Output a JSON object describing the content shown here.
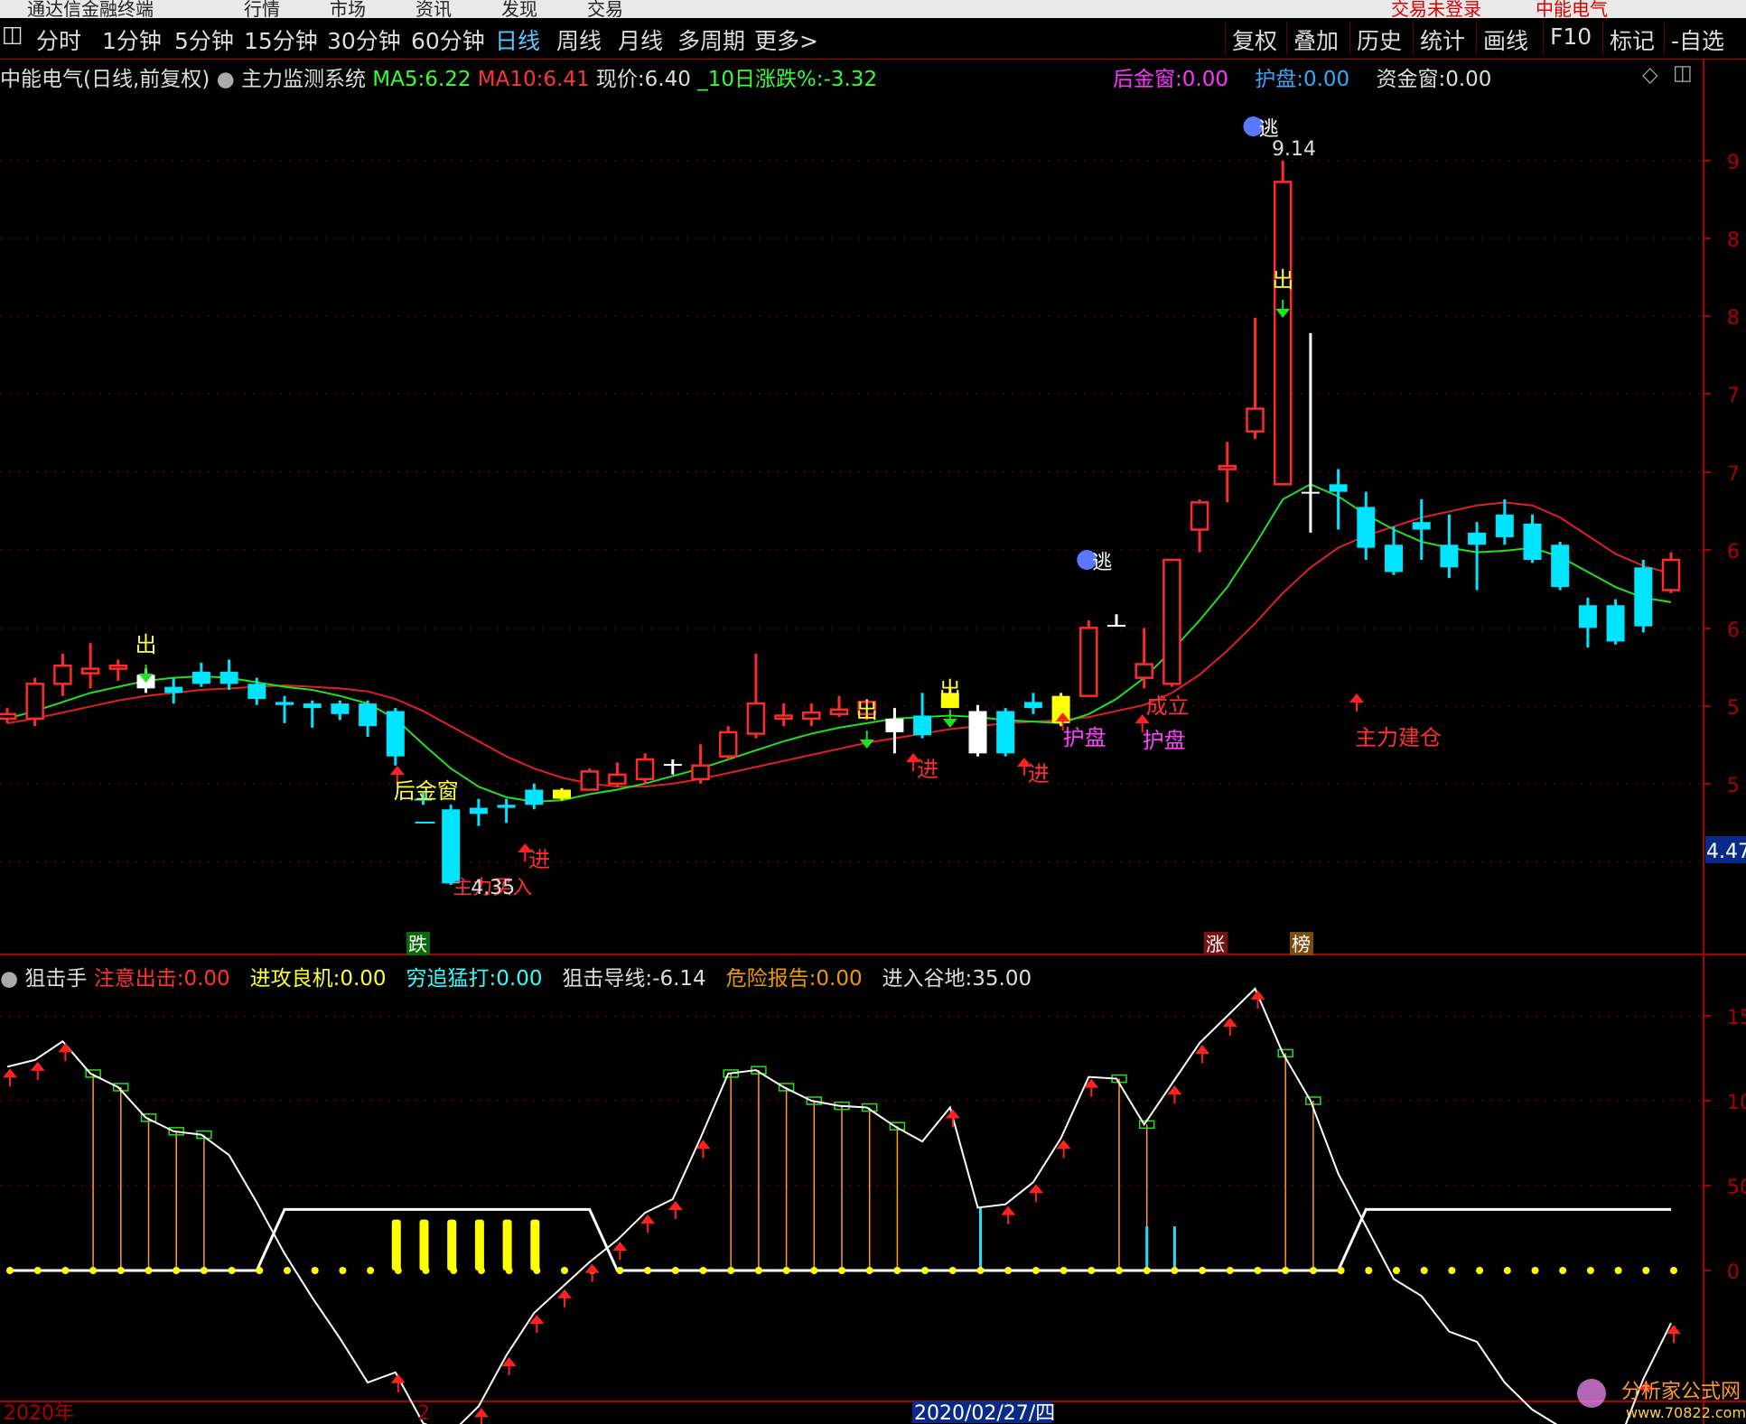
{
  "top_bar": {
    "left_items": [
      "通达信金融终端",
      "行情",
      "市场",
      "资讯",
      "发现",
      "交易"
    ],
    "right_items": [
      "交易未登录",
      "中能电气"
    ]
  },
  "toolbar": {
    "periods": [
      "分时",
      "1分钟",
      "5分钟",
      "15分钟",
      "30分钟",
      "60分钟",
      "日线",
      "周线",
      "月线",
      "多周期",
      "更多>"
    ],
    "active_period": "日线",
    "right_buttons": [
      "复权",
      "叠加",
      "历史",
      "统计",
      "画线",
      "F10",
      "标记",
      "-自选"
    ]
  },
  "main_info": {
    "stock": "中能电气(日线,前复权)",
    "indicator": "主力监测系统",
    "ma5_label": "MA5:",
    "ma5_value": "6.22",
    "ma10_label": "MA10:",
    "ma10_value": "6.41",
    "price_label": "现价:",
    "price_value": "6.40",
    "change_label": "_10日涨跌%:",
    "change_value": "-3.32",
    "hjc_label": "后金窗:",
    "hjc_value": "0.00",
    "hp_label": "护盘:",
    "hp_value": "0.00",
    "zjc_label": "资金窗:",
    "zjc_value": "0.00"
  },
  "sub_info": {
    "indicator": "狙击手",
    "zycj_label": "注意出击:",
    "zycj_value": "0.00",
    "jglj_label": "进攻良机:",
    "jglj_value": "0.00",
    "qzmd_label": "穷追猛打:",
    "qzmd_value": "0.00",
    "jjdx_label": "狙击导线:",
    "jjdx_value": "-6.14",
    "wxbg_label": "危险报告:",
    "wxbg_value": "0.00",
    "jrgd_label": "进入谷地:",
    "jrgd_value": "35.00"
  },
  "price_axis_ticks": [
    "9",
    "8",
    "8",
    "7",
    "7",
    "6",
    "6",
    "5",
    "5"
  ],
  "current_price_tag": "4.47",
  "sub_axis_ticks": [
    "15",
    "10",
    "50",
    "0"
  ],
  "date_labels": {
    "left": "2020年",
    "mid": "2",
    "cursor": "2020/02/27/四"
  },
  "watermark": {
    "name": "分析家公式网",
    "url": "www.70822.com"
  },
  "chart_labels": {
    "out": "出",
    "escape": "逃",
    "enter": "进",
    "hjc": "后金窗",
    "hupan": "护盘",
    "chengli": "成立",
    "jiancang": "主力建仓",
    "low_text": "主力买入",
    "dash": "一",
    "die": "跌",
    "zhang": "涨",
    "bang": "榜",
    "high_price": "9.14",
    "low_price": "4.35"
  },
  "chart_data": {
    "type": "candlestick",
    "x_start_label": "2020年",
    "ylim": [
      4.2,
      9.4
    ],
    "candles": [
      [
        5.45,
        5.52,
        5.42,
        5.48,
        "r"
      ],
      [
        5.45,
        5.72,
        5.4,
        5.68,
        "r"
      ],
      [
        5.68,
        5.88,
        5.6,
        5.8,
        "r"
      ],
      [
        5.75,
        5.95,
        5.65,
        5.78,
        "r"
      ],
      [
        5.78,
        5.84,
        5.7,
        5.8,
        "r"
      ],
      [
        5.74,
        5.78,
        5.62,
        5.65,
        "w"
      ],
      [
        5.66,
        5.72,
        5.55,
        5.62,
        "c"
      ],
      [
        5.68,
        5.82,
        5.66,
        5.76,
        "c"
      ],
      [
        5.76,
        5.84,
        5.64,
        5.68,
        "c"
      ],
      [
        5.68,
        5.72,
        5.54,
        5.58,
        "c"
      ],
      [
        5.56,
        5.6,
        5.42,
        5.54,
        "c"
      ],
      [
        5.55,
        5.57,
        5.39,
        5.52,
        "c"
      ],
      [
        5.55,
        5.57,
        5.44,
        5.48,
        "c"
      ],
      [
        5.55,
        5.57,
        5.33,
        5.4,
        "c"
      ],
      [
        5.5,
        5.52,
        5.14,
        5.2,
        "c"
      ],
      [
        4.92,
        4.96,
        4.88,
        4.92,
        "c"
      ],
      [
        4.85,
        4.88,
        4.35,
        4.36,
        "c"
      ],
      [
        4.82,
        4.92,
        4.74,
        4.86,
        "c"
      ],
      [
        4.88,
        4.92,
        4.76,
        4.86,
        "c"
      ],
      [
        4.98,
        5.02,
        4.85,
        4.88,
        "c"
      ],
      [
        4.92,
        4.99,
        4.91,
        4.98,
        "y"
      ],
      [
        4.98,
        5.12,
        4.98,
        5.1,
        "r"
      ],
      [
        5.02,
        5.16,
        5.0,
        5.08,
        "r"
      ],
      [
        5.05,
        5.22,
        5.02,
        5.18,
        "r"
      ],
      [
        5.15,
        5.18,
        5.08,
        5.14,
        "w"
      ],
      [
        5.05,
        5.28,
        5.02,
        5.14,
        "r"
      ],
      [
        5.2,
        5.4,
        5.18,
        5.36,
        "r"
      ],
      [
        5.35,
        5.88,
        5.32,
        5.55,
        "r"
      ],
      [
        5.45,
        5.55,
        5.4,
        5.47,
        "r"
      ],
      [
        5.45,
        5.55,
        5.4,
        5.49,
        "r"
      ],
      [
        5.48,
        5.6,
        5.46,
        5.51,
        "r"
      ],
      [
        5.48,
        5.58,
        5.44,
        5.56,
        "r"
      ],
      [
        5.45,
        5.52,
        5.22,
        5.36,
        "w"
      ],
      [
        5.47,
        5.62,
        5.32,
        5.34,
        "c"
      ],
      [
        5.62,
        5.66,
        5.52,
        5.52,
        "y"
      ],
      [
        5.5,
        5.54,
        5.2,
        5.22,
        "w"
      ],
      [
        5.5,
        5.52,
        5.2,
        5.22,
        "c"
      ],
      [
        5.56,
        5.62,
        5.48,
        5.52,
        "c"
      ],
      [
        5.6,
        5.62,
        5.4,
        5.42,
        "y"
      ],
      [
        5.6,
        6.1,
        5.6,
        6.05,
        "r"
      ],
      [
        6.07,
        6.14,
        6.06,
        6.07,
        "w"
      ],
      [
        5.72,
        6.05,
        5.65,
        5.81,
        "r"
      ],
      [
        5.68,
        6.5,
        5.66,
        6.5,
        "r"
      ],
      [
        6.7,
        6.9,
        6.55,
        6.88,
        "r"
      ],
      [
        7.1,
        7.28,
        6.88,
        7.12,
        "r"
      ],
      [
        7.35,
        8.1,
        7.3,
        7.5,
        "r"
      ],
      [
        7.0,
        9.14,
        7.0,
        9.0,
        "r"
      ],
      [
        6.95,
        8.0,
        6.68,
        6.95,
        "w"
      ],
      [
        6.95,
        7.1,
        6.7,
        7.0,
        "c"
      ],
      [
        6.85,
        6.95,
        6.5,
        6.58,
        "c"
      ],
      [
        6.6,
        6.72,
        6.4,
        6.42,
        "c"
      ],
      [
        6.7,
        6.9,
        6.5,
        6.75,
        "c"
      ],
      [
        6.6,
        6.8,
        6.38,
        6.45,
        "c"
      ],
      [
        6.68,
        6.75,
        6.3,
        6.6,
        "c"
      ],
      [
        6.65,
        6.9,
        6.6,
        6.8,
        "c"
      ],
      [
        6.74,
        6.8,
        6.48,
        6.5,
        "c"
      ],
      [
        6.6,
        6.62,
        6.3,
        6.32,
        "c"
      ],
      [
        6.2,
        6.25,
        5.92,
        6.05,
        "c"
      ],
      [
        6.2,
        6.24,
        5.94,
        5.96,
        "c"
      ],
      [
        6.45,
        6.5,
        6.02,
        6.06,
        "c"
      ],
      [
        6.3,
        6.55,
        6.28,
        6.5,
        "r"
      ]
    ],
    "ma5": [
      5.45,
      5.5,
      5.56,
      5.62,
      5.66,
      5.7,
      5.72,
      5.73,
      5.72,
      5.69,
      5.66,
      5.64,
      5.6,
      5.55,
      5.45,
      5.28,
      5.12,
      5.0,
      4.93,
      4.9,
      4.91,
      4.95,
      4.98,
      5.02,
      5.07,
      5.12,
      5.18,
      5.24,
      5.3,
      5.35,
      5.39,
      5.42,
      5.45,
      5.46,
      5.47,
      5.46,
      5.44,
      5.43,
      5.42,
      5.48,
      5.58,
      5.72,
      5.9,
      6.1,
      6.32,
      6.6,
      6.9,
      7.0,
      6.92,
      6.8,
      6.7,
      6.62,
      6.58,
      6.55,
      6.56,
      6.58,
      6.52,
      6.42,
      6.32,
      6.25,
      6.22
    ],
    "ma10": [
      5.42,
      5.45,
      5.49,
      5.53,
      5.57,
      5.6,
      5.62,
      5.64,
      5.65,
      5.66,
      5.67,
      5.66,
      5.65,
      5.63,
      5.58,
      5.5,
      5.4,
      5.3,
      5.2,
      5.12,
      5.06,
      5.02,
      5.0,
      5.0,
      5.02,
      5.05,
      5.09,
      5.13,
      5.17,
      5.21,
      5.25,
      5.29,
      5.32,
      5.35,
      5.38,
      5.4,
      5.42,
      5.43,
      5.44,
      5.46,
      5.5,
      5.54,
      5.62,
      5.74,
      5.9,
      6.08,
      6.28,
      6.45,
      6.58,
      6.66,
      6.72,
      6.78,
      6.82,
      6.86,
      6.88,
      6.86,
      6.78,
      6.66,
      6.54,
      6.46,
      6.41
    ],
    "sub_ylim": [
      -18,
      17
    ],
    "sub_line": [
      12.0,
      12.4,
      13.5,
      11.6,
      10.8,
      9.0,
      8.2,
      8.0,
      6.8,
      4.0,
      1.0,
      -1.6,
      -4.0,
      -6.6,
      -6.0,
      -9.0,
      -9.6,
      -8.0,
      -5.0,
      -2.5,
      -1.0,
      0.5,
      1.8,
      3.4,
      4.2,
      7.8,
      11.6,
      11.8,
      10.8,
      10.0,
      9.7,
      9.6,
      8.5,
      7.6,
      9.6,
      3.7,
      3.9,
      5.2,
      7.8,
      11.4,
      11.3,
      8.6,
      11.0,
      13.4,
      15.0,
      16.6,
      12.8,
      10.0,
      5.7,
      2.6,
      -0.5,
      -1.5,
      -3.6,
      -4.2,
      -6.6,
      -8.2,
      -9.2,
      -9.4,
      -10.6,
      -6.4,
      -3.1
    ],
    "sub_step": [
      [
        0,
        0
      ],
      [
        9,
        0
      ],
      [
        10,
        3.6
      ],
      [
        21,
        3.6
      ],
      [
        22,
        0
      ],
      [
        48,
        0
      ],
      [
        49,
        3.6
      ],
      [
        60,
        3.6
      ]
    ]
  }
}
